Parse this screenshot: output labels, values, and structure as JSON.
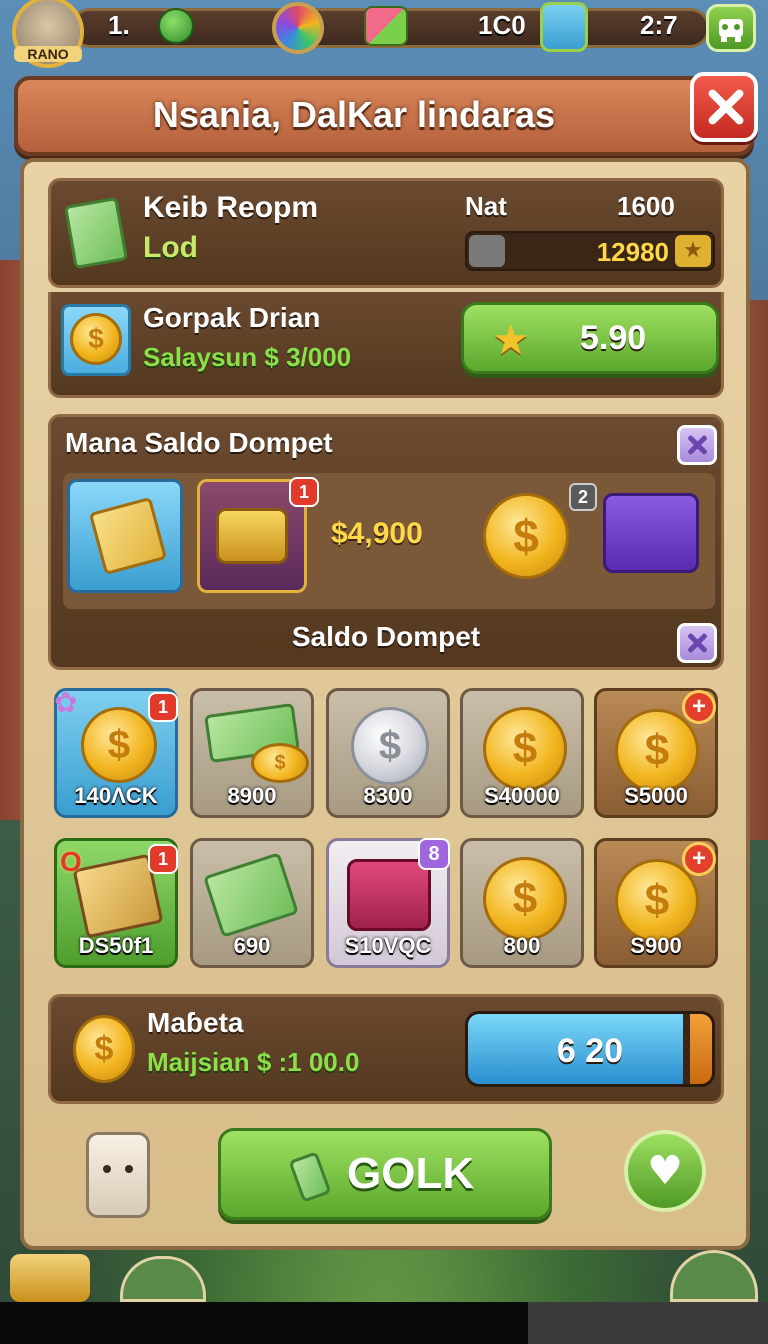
{
  "hud": {
    "avatar_label": "RANO",
    "stat_1": "1.",
    "stat_2": "1C0",
    "stat_3": "2:7"
  },
  "title": "Nsania, DalKar lindaras",
  "reward_card": {
    "name": "Keib Reopm",
    "subtitle": "Lod",
    "stat_label": "Nat",
    "stat_max": "1600",
    "progress_value": "12980"
  },
  "offer": {
    "name": "Gorpak Drian",
    "detail": "Salaysun $ 3/000",
    "button_label": "5.90"
  },
  "wallet_section": {
    "title": "Mana Saldo Dompet",
    "amount": "$4,900",
    "badge": "2",
    "footer": "Saldo Dompet"
  },
  "items_row_1": [
    {
      "label": "140ΛCK",
      "badge": "1"
    },
    {
      "label": "8900"
    },
    {
      "label": "8300"
    },
    {
      "label": "S40000"
    },
    {
      "label": "S5000",
      "plus": "+"
    }
  ],
  "items_row_2": [
    {
      "label": "DS50f1",
      "badge": "1",
      "corner": "O"
    },
    {
      "label": "690"
    },
    {
      "label": "S10VQC",
      "badge": "8"
    },
    {
      "label": "800"
    },
    {
      "label": "S900",
      "plus": "+"
    }
  ],
  "bottom_card": {
    "name": "Maɓeta",
    "detail": "Maijsian $ :1 00.0",
    "bar_value": "6 20",
    "bar_fraction": 0.88
  },
  "action_button": "GOLK",
  "colors": {
    "accent_green": "#5aa82c",
    "title_orange": "#c9704a",
    "close_red": "#d8332a",
    "text_yellow": "#ffd84a",
    "panel": "#e0c79a"
  }
}
